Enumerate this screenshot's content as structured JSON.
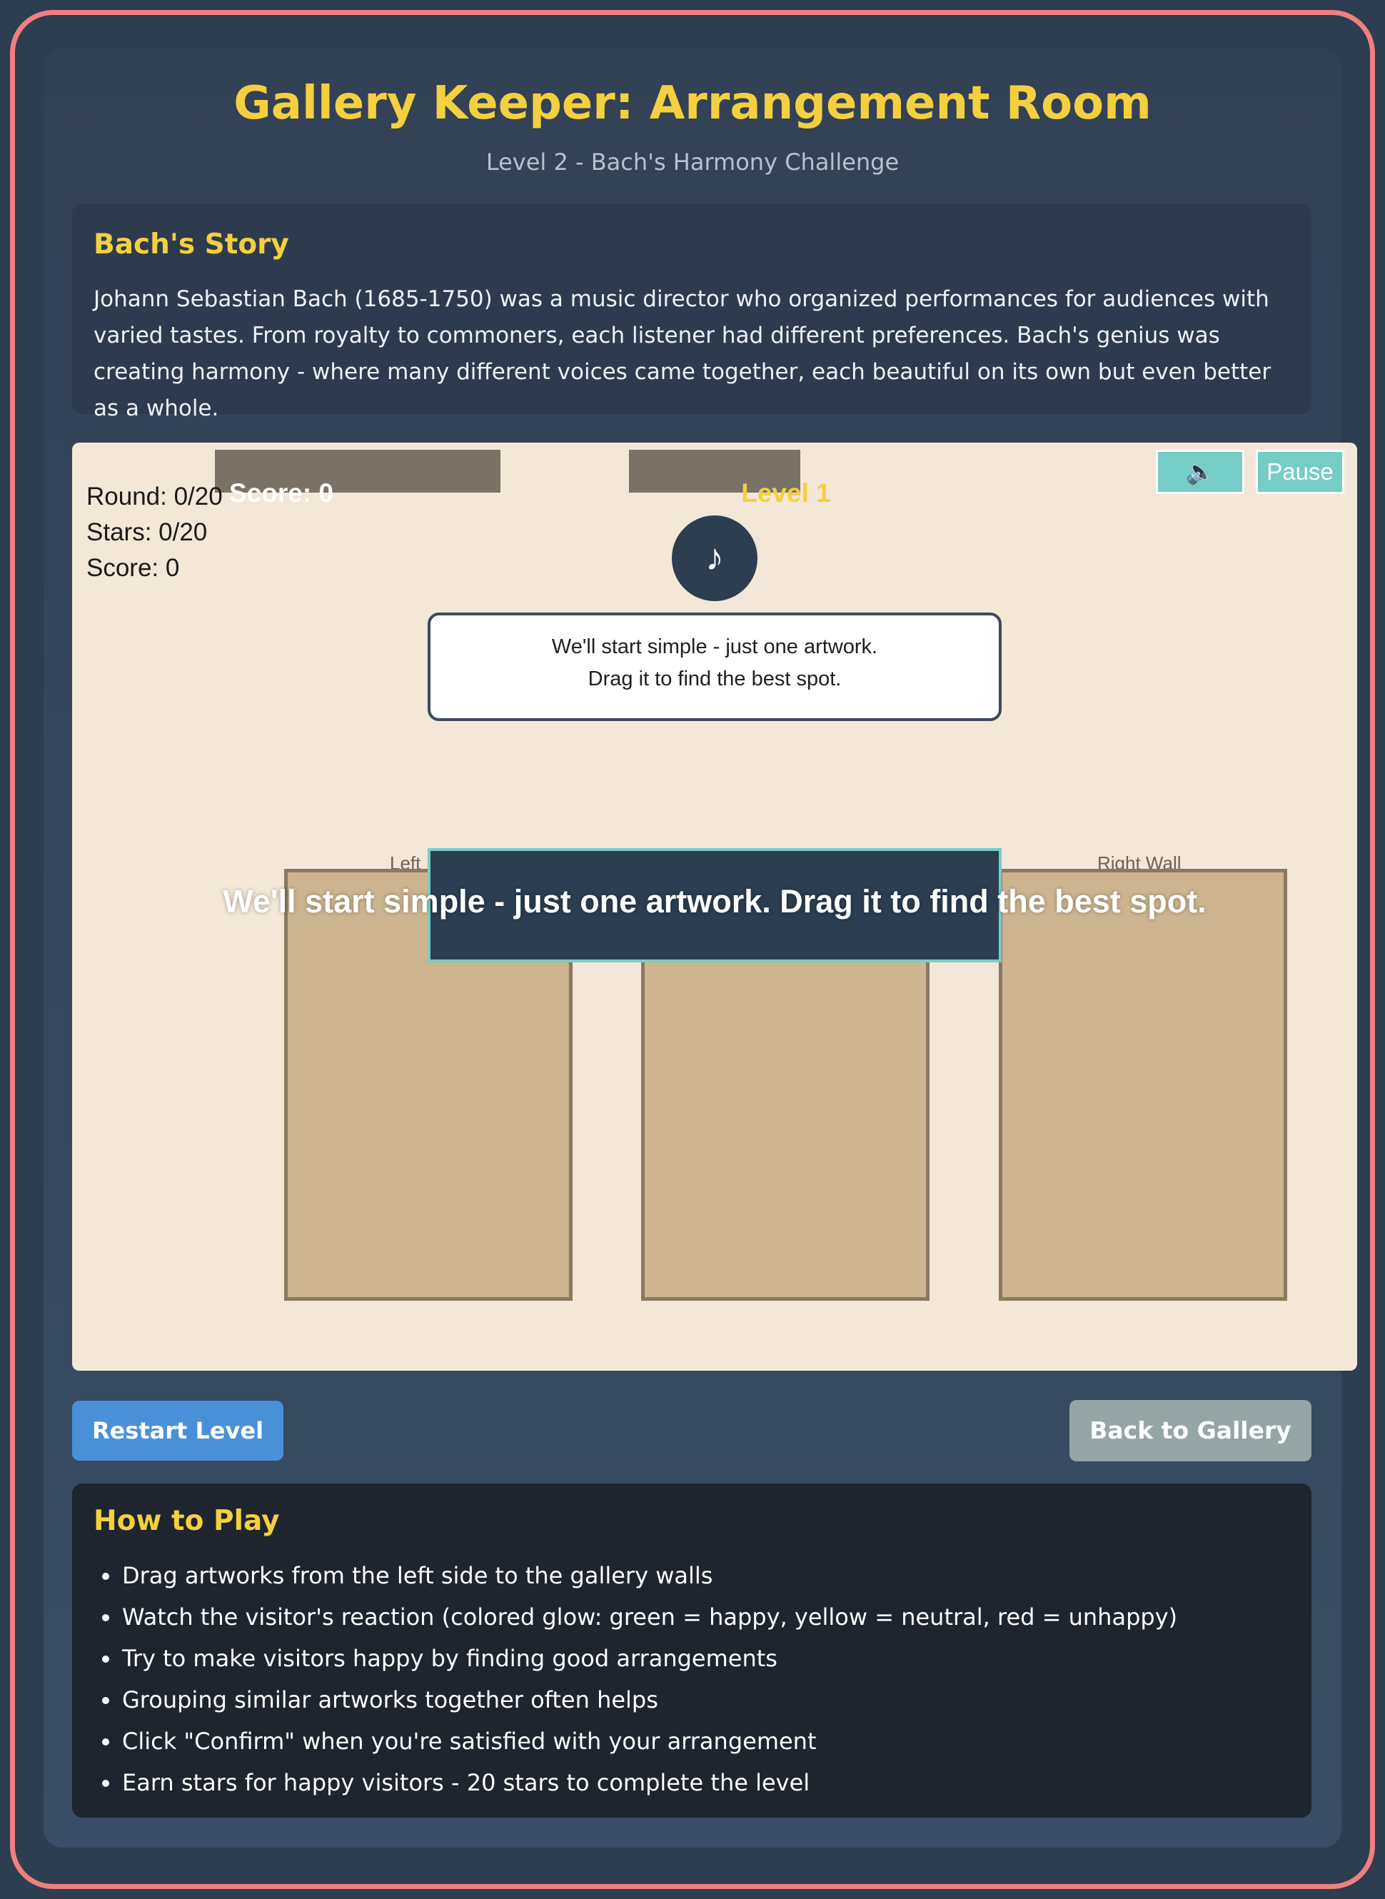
{
  "header": {
    "title": "Gallery Keeper: Arrangement Room",
    "subtitle": "Level 2 - Bach's Harmony Challenge"
  },
  "story": {
    "heading": "Bach's Story",
    "text": "Johann Sebastian Bach (1685-1750) was a music director who organized performances for audiences with varied tastes. From royalty to commoners, each listener had different preferences. Bach's genius was creating harmony - where many different voices came together, each beautiful on its own but even better as a whole."
  },
  "game": {
    "hud": {
      "round": "Round: 0/20",
      "stars": "Stars: 0/20",
      "score": "Score: 0",
      "score_overlay": "Score: 0",
      "level": "Level 1"
    },
    "sound_icon": "speaker-icon",
    "sound_glyph": "🔈",
    "pause_label": "Pause",
    "note_glyph": "♪",
    "speech_line1": "We'll start simple - just one artwork.",
    "speech_line2": "Drag it to find the best spot.",
    "walls": {
      "left_label": "Left",
      "right_label": "Right Wall"
    },
    "toast_text": "We'll start simple - just one artwork. Drag it to find the best spot."
  },
  "controls": {
    "restart_label": "Restart Level",
    "back_label": "Back to Gallery"
  },
  "howto": {
    "heading": "How to Play",
    "items": [
      "Drag artworks from the left side to the gallery walls",
      "Watch the visitor's reaction (colored glow: green = happy, yellow = neutral, red = unhappy)",
      "Try to make visitors happy by finding good arrangements",
      "Grouping similar artworks together often helps",
      "Click \"Confirm\" when you're satisfied with your arrangement",
      "Earn stars for happy visitors - 20 stars to complete the level"
    ]
  },
  "colors": {
    "accent_yellow": "#f4d03f",
    "teal": "#76cdc6",
    "restart_blue": "#4a90d9",
    "back_gray": "#95a5a6",
    "frame_pink": "#f08080"
  }
}
